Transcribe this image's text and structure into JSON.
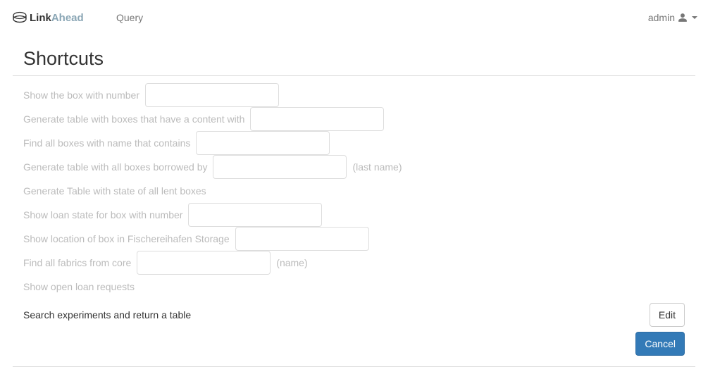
{
  "nav": {
    "brand_text": "LinkAhead",
    "query_label": "Query",
    "user_label": "admin"
  },
  "panel": {
    "title": "Shortcuts"
  },
  "shortcuts": [
    {
      "prefix": "Show the box with number",
      "has_input": true,
      "suffix": ""
    },
    {
      "prefix": "Generate table with boxes that have a content with",
      "has_input": true,
      "suffix": ""
    },
    {
      "prefix": "Find all boxes with name that contains",
      "has_input": true,
      "suffix": ""
    },
    {
      "prefix": "Generate table with all boxes borrowed by",
      "has_input": true,
      "suffix": "(last name)"
    },
    {
      "prefix": "Generate Table with state of all lent boxes",
      "has_input": false,
      "suffix": ""
    },
    {
      "prefix": "Show loan state for box with number",
      "has_input": true,
      "suffix": ""
    },
    {
      "prefix": "Show location of box in Fischereihafen Storage",
      "has_input": true,
      "suffix": ""
    },
    {
      "prefix": "Find all fabrics from core",
      "has_input": true,
      "suffix": "(name)"
    },
    {
      "prefix": "Show open loan requests",
      "has_input": false,
      "suffix": ""
    }
  ],
  "active_shortcut": {
    "label": "Search experiments and return a table",
    "edit_button": "Edit"
  },
  "cancel_button": "Cancel"
}
